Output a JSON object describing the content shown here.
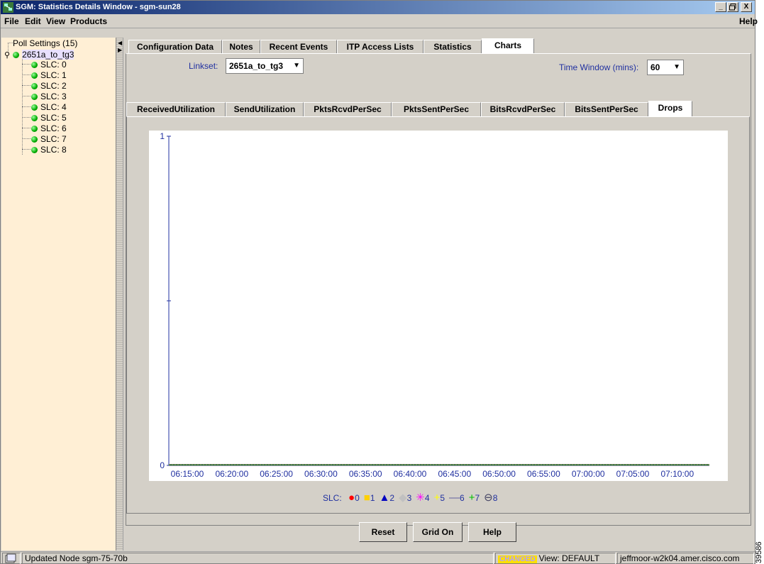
{
  "window": {
    "title": "SGM: Statistics Details Window - sgm-sun28",
    "controls": [
      "_",
      "̸",
      "X"
    ]
  },
  "menu": {
    "file": "File",
    "edit": "Edit",
    "view": "View",
    "products": "Products",
    "help": "Help"
  },
  "tree": {
    "root": "Poll Settings (15)",
    "linkset": "2651a_to_tg3",
    "slcs": [
      "SLC: 0",
      "SLC: 1",
      "SLC: 2",
      "SLC: 3",
      "SLC: 4",
      "SLC: 5",
      "SLC: 6",
      "SLC: 7",
      "SLC: 8"
    ]
  },
  "top_tabs": [
    "Configuration Data",
    "Notes",
    "Recent Events",
    "ITP Access Lists",
    "Statistics",
    "Charts"
  ],
  "active_top_tab": "Charts",
  "controls": {
    "linkset_label": "Linkset:",
    "linkset_value": "2651a_to_tg3",
    "time_window_label": "Time Window (mins):",
    "time_window_value": "60"
  },
  "chart_tabs": [
    "ReceivedUtilization",
    "SendUtilization",
    "PktsRcvdPerSec",
    "PktsSentPerSec",
    "BitsRcvdPerSec",
    "BitsSentPerSec",
    "Drops"
  ],
  "active_chart_tab": "Drops",
  "chart_data": {
    "type": "line",
    "title": "",
    "xlabel": "",
    "ylabel": "",
    "ylim": [
      0,
      1
    ],
    "y_ticks": [
      "1",
      "0"
    ],
    "x": [
      "06:15:00",
      "06:20:00",
      "06:25:00",
      "06:30:00",
      "06:35:00",
      "06:40:00",
      "06:45:00",
      "06:50:00",
      "06:55:00",
      "07:00:00",
      "07:05:00",
      "07:10:00"
    ],
    "legend_title": "SLC:",
    "series": [
      {
        "name": "0",
        "color": "#ff0000",
        "marker": "circle",
        "values": [
          0,
          0,
          0,
          0,
          0,
          0,
          0,
          0,
          0,
          0,
          0,
          0
        ]
      },
      {
        "name": "1",
        "color": "#ffd000",
        "marker": "square",
        "values": [
          0,
          0,
          0,
          0,
          0,
          0,
          0,
          0,
          0,
          0,
          0,
          0
        ]
      },
      {
        "name": "2",
        "color": "#0000c0",
        "marker": "triangle",
        "values": [
          0,
          0,
          0,
          0,
          0,
          0,
          0,
          0,
          0,
          0,
          0,
          0
        ]
      },
      {
        "name": "3",
        "color": "#c0c0c0",
        "marker": "diamond",
        "values": [
          0,
          0,
          0,
          0,
          0,
          0,
          0,
          0,
          0,
          0,
          0,
          0
        ]
      },
      {
        "name": "4",
        "color": "#ff00ff",
        "marker": "asterisk",
        "values": [
          0,
          0,
          0,
          0,
          0,
          0,
          0,
          0,
          0,
          0,
          0,
          0
        ]
      },
      {
        "name": "5",
        "color": "#ffff00",
        "marker": "plus",
        "values": [
          0,
          0,
          0,
          0,
          0,
          0,
          0,
          0,
          0,
          0,
          0,
          0
        ]
      },
      {
        "name": "6",
        "color": "#6060a0",
        "marker": "dash",
        "values": [
          0,
          0,
          0,
          0,
          0,
          0,
          0,
          0,
          0,
          0,
          0,
          0
        ]
      },
      {
        "name": "7",
        "color": "#00c000",
        "marker": "plus",
        "values": [
          0,
          0,
          0,
          0,
          0,
          0,
          0,
          0,
          0,
          0,
          0,
          0
        ]
      },
      {
        "name": "8",
        "color": "#404060",
        "marker": "theta",
        "values": [
          0,
          0,
          0,
          0,
          0,
          0,
          0,
          0,
          0,
          0,
          0,
          0
        ]
      }
    ],
    "legend_placement": "bottom-center",
    "grid": false
  },
  "buttons": {
    "reset": "Reset",
    "grid_on": "Grid On",
    "help": "Help"
  },
  "status": {
    "message": "Updated Node sgm-75-70b",
    "changed": "CHANGED",
    "view": "View: DEFAULT",
    "user": "jeffmoor-w2k04.amer.cisco.com"
  },
  "side_id": "39586",
  "icons": {
    "app": "network-app-icon",
    "status": "document-icon",
    "tree_root": "pin-icon"
  }
}
